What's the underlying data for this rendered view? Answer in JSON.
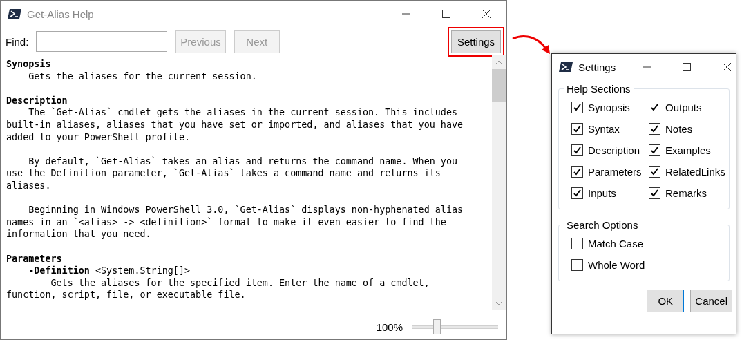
{
  "help_window": {
    "title": "Get-Alias Help",
    "active": false,
    "find": {
      "label": "Find:"
    },
    "buttons": [
      {
        "label": "Previous",
        "disabled": true,
        "highlighted": false
      },
      {
        "label": "Next",
        "disabled": true,
        "highlighted": false
      },
      {
        "label": "Settings",
        "disabled": false,
        "highlighted": true
      }
    ],
    "sections": [
      {
        "heading": "Synopsis",
        "paragraphs": [
          {
            "text": "    Gets the aliases for the current session."
          }
        ]
      },
      {
        "heading": "Description",
        "paragraphs": [
          {
            "text": "    The `Get-Alias` cmdlet gets the aliases in the current session. This includes\nbuilt-in aliases, aliases that you have set or imported, and aliases that you have\nadded to your PowerShell profile."
          },
          {
            "text": "    By default, `Get-Alias` takes an alias and returns the command name. When you\nuse the Definition parameter, `Get-Alias` takes a command name and returns its\naliases."
          },
          {
            "text": "    Beginning in Windows PowerShell 3.0, `Get-Alias` displays non-hyphenated alias\nnames in an `<alias> -> <definition>` format to make it even easier to find the\ninformation that you need."
          }
        ]
      },
      {
        "heading": "Parameters",
        "paragraphs": [
          {
            "text": "    **-Definition** <System.String[]>\n        Gets the aliases for the specified item. Enter the name of a cmdlet,\nfunction, script, file, or executable file."
          }
        ]
      }
    ],
    "zoom": {
      "reading": "100%",
      "level": 0.28
    }
  },
  "settings_window": {
    "title": "Settings",
    "groups": [
      {
        "title": "Help Sections",
        "items": [
          {
            "label": "Synopsis",
            "checked": true
          },
          {
            "label": "Outputs",
            "checked": true
          },
          {
            "label": "Syntax",
            "checked": true
          },
          {
            "label": "Notes",
            "checked": true
          },
          {
            "label": "Description",
            "checked": true
          },
          {
            "label": "Examples",
            "checked": true
          },
          {
            "label": "Parameters",
            "checked": true
          },
          {
            "label": "RelatedLinks",
            "checked": true
          },
          {
            "label": "Inputs",
            "checked": true
          },
          {
            "label": "Remarks",
            "checked": true
          }
        ]
      },
      {
        "title": "Search Options",
        "items": [
          {
            "label": "Match Case",
            "checked": false
          },
          {
            "label": "Whole Word",
            "checked": false
          }
        ]
      }
    ],
    "buttons": [
      {
        "label": "OK",
        "default": true
      },
      {
        "label": "Cancel",
        "default": false
      }
    ]
  }
}
